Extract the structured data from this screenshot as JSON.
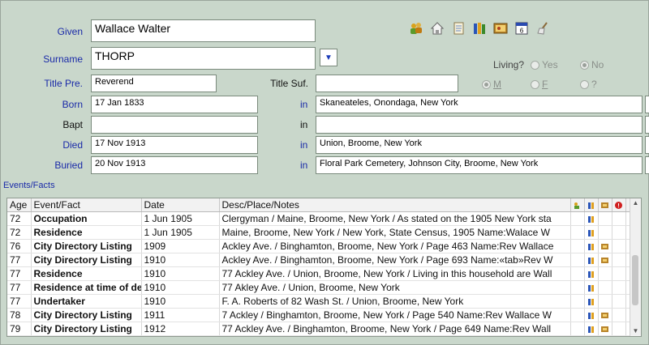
{
  "person": {
    "given_label": "Given",
    "given_value": "Wallace Walter",
    "surname_label": "Surname",
    "surname_value": "THORP",
    "title_pre_label": "Title Pre.",
    "title_pre_value": "Reverend",
    "title_suf_label": "Title Suf.",
    "title_suf_value": "",
    "in_label": "in",
    "born_label": "Born",
    "born_date": "17 Jan 1833",
    "born_place": "Skaneateles, Onondaga, New York",
    "bapt_label": "Bapt",
    "bapt_date": "",
    "bapt_place": "",
    "died_label": "Died",
    "died_date": "17 Nov 1913",
    "died_place": "Union, Broome, New York",
    "buried_label": "Buried",
    "buried_date": "20 Nov 1913",
    "buried_place": "Floral Park Cemetery, Johnson City, Broome, New York"
  },
  "living": {
    "label": "Living?",
    "yes": "Yes",
    "no": "No",
    "selected": "No"
  },
  "sex": {
    "m": "M",
    "f": "F",
    "unknown": "?",
    "selected": "M"
  },
  "toolbar_icons": [
    "people-icon",
    "home-icon",
    "scroll-icon",
    "books-icon",
    "picture-icon",
    "calendar-icon",
    "broom-icon"
  ],
  "events": {
    "section_title": "Events/Facts",
    "columns": [
      "Age",
      "Event/Fact",
      "Date",
      "Desc/Place/Notes"
    ],
    "rows": [
      {
        "age": "72",
        "event": "Occupation",
        "date": "1 Jun 1905",
        "desc": "Clergyman / Maine, Broome, New York / As stated on the 1905 New York sta"
      },
      {
        "age": "72",
        "event": "Residence",
        "date": "1 Jun 1905",
        "desc": "Maine, Broome, New York / New York, State Census, 1905 Name:Walace W"
      },
      {
        "age": "76",
        "event": "City Directory Listing",
        "date": "1909",
        "desc": "Ackley Ave. / Binghamton, Broome, New York / Page 463 Name:Rev Wallace"
      },
      {
        "age": "77",
        "event": "City Directory Listing",
        "date": "1910",
        "desc": "Ackley Ave. / Binghamton, Broome, New York / Page 693 Name:«tab»Rev W"
      },
      {
        "age": "77",
        "event": "Residence",
        "date": "1910",
        "desc": "77 Ackley Ave. / Union, Broome, New York / Living in this household are Wall"
      },
      {
        "age": "77",
        "event": "Residence at time of death",
        "date": "1910",
        "desc": "77 Akley Ave. / Union, Broome, New York"
      },
      {
        "age": "77",
        "event": "Undertaker",
        "date": "1910",
        "desc": "F. A. Roberts of 82 Wash St. / Union, Broome, New York"
      },
      {
        "age": "78",
        "event": "City Directory Listing",
        "date": "1911",
        "desc": "7 Ackley / Binghamton, Broome, New York / Page 540 Name:Rev Wallace W"
      },
      {
        "age": "79",
        "event": "City Directory Listing",
        "date": "1912",
        "desc": "77 Ackley Ave. / Binghamton, Broome, New York / Page 649 Name:Rev Wall"
      }
    ]
  },
  "colors": {
    "background": "#c9d7cb",
    "label_blue": "#1a2aa8"
  }
}
